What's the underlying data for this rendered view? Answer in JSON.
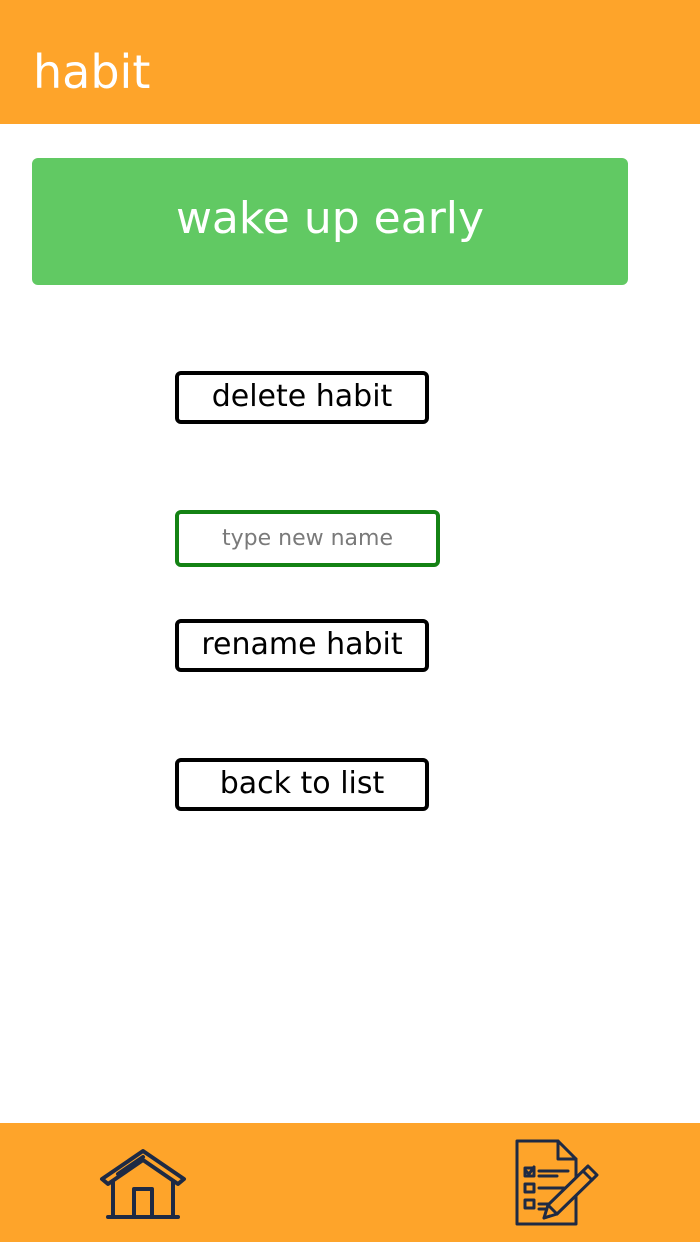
{
  "header": {
    "title": "habit"
  },
  "habit": {
    "name": "wake up early"
  },
  "actions": {
    "delete_label": "delete habit",
    "rename_placeholder": "type new name",
    "rename_value": "",
    "rename_label": "rename habit",
    "back_label": "back to list"
  },
  "bottom_nav": {
    "items": [
      {
        "icon": "home-icon"
      },
      {
        "icon": "checklist-edit-icon"
      }
    ]
  },
  "colors": {
    "bar": "#fea42a",
    "card": "#61c963",
    "input_border": "#148214",
    "icon_stroke": "#1e2a44"
  }
}
